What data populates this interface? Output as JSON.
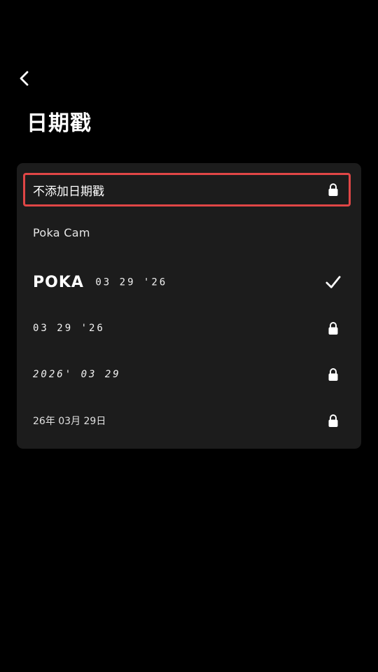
{
  "header": {
    "back_icon": "chevron-left-icon",
    "title": "日期戳"
  },
  "options": [
    {
      "id": "none",
      "label": "不添加日期戳",
      "trailing": "lock-icon",
      "highlighted": true,
      "selected": false
    },
    {
      "id": "poka-cam",
      "label": "Poka Cam",
      "trailing": "",
      "highlighted": false,
      "selected": false
    },
    {
      "id": "poka-date",
      "brand": "POKA",
      "label": "03 29 '26",
      "trailing": "checkmark-icon",
      "highlighted": false,
      "selected": true
    },
    {
      "id": "digital-mdy",
      "label": "03 29 '26",
      "trailing": "lock-icon",
      "highlighted": false,
      "selected": false
    },
    {
      "id": "digital-ymd",
      "label": "2026' 03 29",
      "trailing": "lock-icon",
      "highlighted": false,
      "selected": false
    },
    {
      "id": "cn-date",
      "label": "26年 03月 29日",
      "trailing": "lock-icon",
      "highlighted": false,
      "selected": false
    }
  ],
  "colors": {
    "background": "#000000",
    "card": "#1c1c1c",
    "highlight_border": "#e04646",
    "text": "#ffffff"
  }
}
